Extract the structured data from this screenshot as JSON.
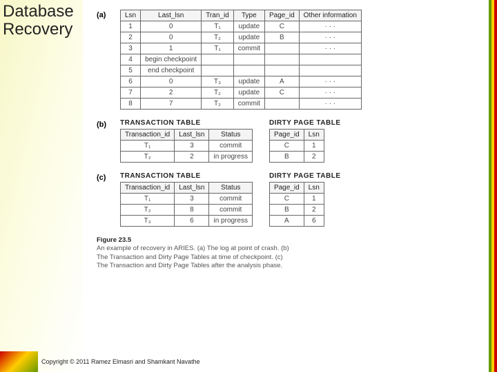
{
  "title_l1": "Database",
  "title_l2": "Recovery",
  "panel_a": {
    "label": "(a)",
    "chart_data": {
      "type": "table",
      "columns": [
        "Lsn",
        "Last_lsn",
        "Tran_id",
        "Type",
        "Page_id",
        "Other information"
      ],
      "rows": [
        [
          "1",
          "0",
          "T₁",
          "update",
          "C",
          "· · ·"
        ],
        [
          "2",
          "0",
          "T₂",
          "update",
          "B",
          "· · ·"
        ],
        [
          "3",
          "1",
          "T₁",
          "commit",
          "",
          "· · ·"
        ],
        [
          "4",
          "begin checkpoint",
          "",
          "",
          "",
          ""
        ],
        [
          "5",
          "end checkpoint",
          "",
          "",
          "",
          ""
        ],
        [
          "6",
          "0",
          "T₃",
          "update",
          "A",
          "· · ·"
        ],
        [
          "7",
          "2",
          "T₂",
          "update",
          "C",
          "· · ·"
        ],
        [
          "8",
          "7",
          "T₂",
          "commit",
          "",
          "· · ·"
        ]
      ]
    }
  },
  "panel_b": {
    "label": "(b)",
    "trans": {
      "title": "TRANSACTION TABLE",
      "chart_data": {
        "type": "table",
        "columns": [
          "Transaction_id",
          "Last_lsn",
          "Status"
        ],
        "rows": [
          [
            "T₁",
            "3",
            "commit"
          ],
          [
            "T₂",
            "2",
            "in progress"
          ]
        ]
      }
    },
    "dirty": {
      "title": "DIRTY PAGE TABLE",
      "chart_data": {
        "type": "table",
        "columns": [
          "Page_id",
          "Lsn"
        ],
        "rows": [
          [
            "C",
            "1"
          ],
          [
            "B",
            "2"
          ]
        ]
      }
    }
  },
  "panel_c": {
    "label": "(c)",
    "trans": {
      "title": "TRANSACTION TABLE",
      "chart_data": {
        "type": "table",
        "columns": [
          "Transaction_id",
          "Last_lsn",
          "Status"
        ],
        "rows": [
          [
            "T₁",
            "3",
            "commit"
          ],
          [
            "T₂",
            "8",
            "commit"
          ],
          [
            "T₃",
            "6",
            "in progress"
          ]
        ]
      }
    },
    "dirty": {
      "title": "DIRTY PAGE TABLE",
      "chart_data": {
        "type": "table",
        "columns": [
          "Page_id",
          "Lsn"
        ],
        "rows": [
          [
            "C",
            "1"
          ],
          [
            "B",
            "2"
          ],
          [
            "A",
            "6"
          ]
        ]
      }
    }
  },
  "caption": {
    "fig": "Figure 23.5",
    "text_l1": "An example of recovery in ARIES. (a) The log at point of crash. (b)",
    "text_l2": "The Transaction and Dirty Page Tables at time of checkpoint. (c)",
    "text_l3": "The Transaction and Dirty Page Tables after the analysis phase."
  },
  "copyright": "Copyright © 2011 Ramez Elmasri and Shamkant Navathe"
}
